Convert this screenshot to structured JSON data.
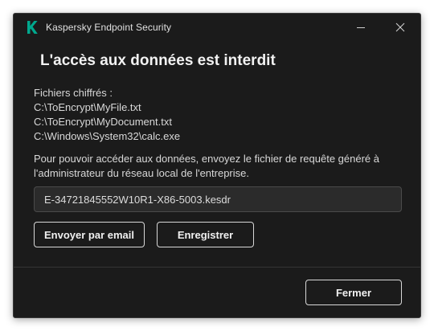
{
  "window": {
    "app_title": "Kaspersky Endpoint Security",
    "logo_icon": "kaspersky-k-logo-icon",
    "logo_color": "#00a88e",
    "minimize_icon": "minimize-icon",
    "close_icon": "close-icon"
  },
  "dialog": {
    "heading": "L'accès aux données est interdit",
    "files_label": "Fichiers chiffrés :",
    "files": [
      "C:\\ToEncrypt\\MyFile.txt",
      "C:\\ToEncrypt\\MyDocument.txt",
      "C:\\Windows\\System32\\calc.exe"
    ],
    "info_text": "Pour pouvoir accéder aux données, envoyez le fichier de requête généré à l'administrateur du réseau local de l'entreprise.",
    "request_file_value": "E-34721845552W10R1-X86-5003.kesdr",
    "email_button_label": "Envoyer par email",
    "save_button_label": "Enregistrer",
    "close_button_label": "Fermer"
  },
  "colors": {
    "background": "#1b1b1b",
    "field_background": "#2b2b2b",
    "text": "#e6e6e6",
    "accent": "#00a88e"
  }
}
